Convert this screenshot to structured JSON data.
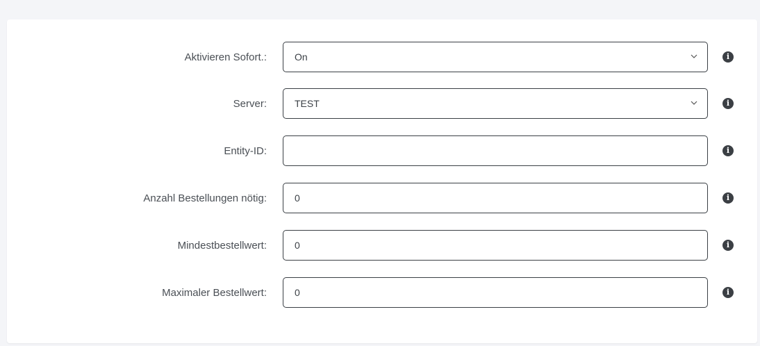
{
  "form": {
    "rows": [
      {
        "label": "Aktivieren Sofort.:",
        "type": "select",
        "value": "On"
      },
      {
        "label": "Server:",
        "type": "select",
        "value": "TEST"
      },
      {
        "label": "Entity-ID:",
        "type": "text",
        "value": ""
      },
      {
        "label": "Anzahl Bestellungen nötig:",
        "type": "text",
        "value": "0"
      },
      {
        "label": "Mindestbestellwert:",
        "type": "text",
        "value": "0"
      },
      {
        "label": "Maximaler Bestellwert:",
        "type": "text",
        "value": "0"
      }
    ]
  },
  "icons": {
    "info": "info-icon",
    "dropdown": "chevron-down-icon"
  },
  "colors": {
    "background": "#f4f5f8",
    "panel": "#ffffff",
    "border": "#3a3f44",
    "label_text": "#4a4f55",
    "info_icon": "#3b3f44"
  }
}
